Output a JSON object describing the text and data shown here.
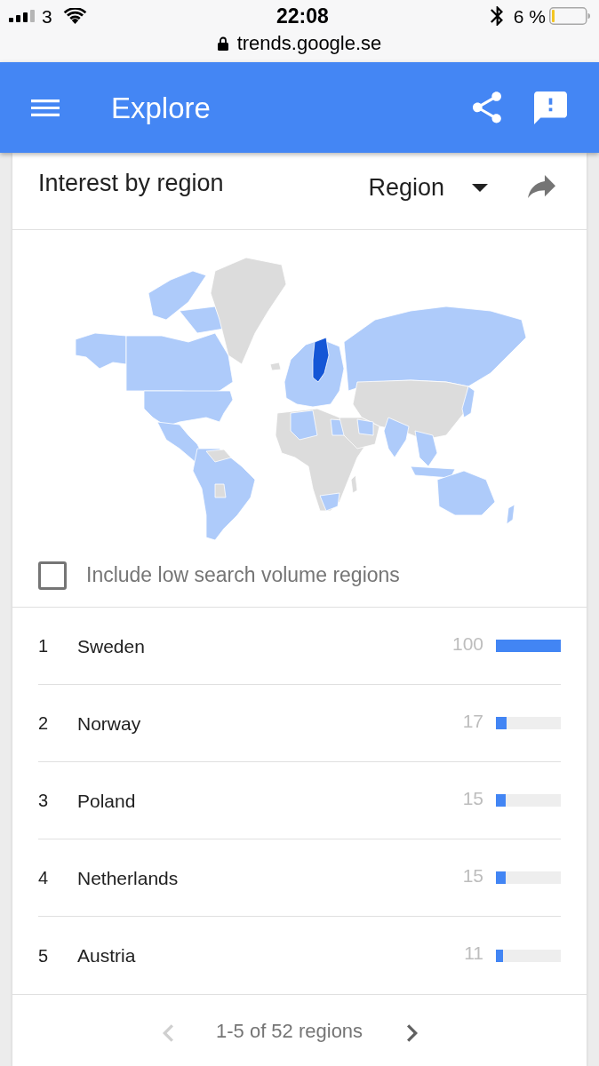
{
  "status_bar": {
    "carrier": "3",
    "time": "22:08",
    "battery_text": "6 %",
    "url": "trends.google.se"
  },
  "app_bar": {
    "title": "Explore"
  },
  "card": {
    "title": "Interest by region",
    "dropdown": {
      "value": "Region"
    }
  },
  "low_volume_option": {
    "label": "Include low search volume regions",
    "checked": false
  },
  "regions": [
    {
      "rank": "1",
      "name": "Sweden",
      "value": "100",
      "level": 1
    },
    {
      "rank": "2",
      "name": "Norway",
      "value": "17",
      "level": 0.17
    },
    {
      "rank": "3",
      "name": "Poland",
      "value": "15",
      "level": 0.15
    },
    {
      "rank": "4",
      "name": "Netherlands",
      "value": "15",
      "level": 0.15
    },
    {
      "rank": "5",
      "name": "Austria",
      "value": "11",
      "level": 0.11
    }
  ],
  "pagination": {
    "prev": {
      "disabled": true
    },
    "text": "1-5 of 52 regions",
    "next": {
      "disabled": false
    }
  }
}
